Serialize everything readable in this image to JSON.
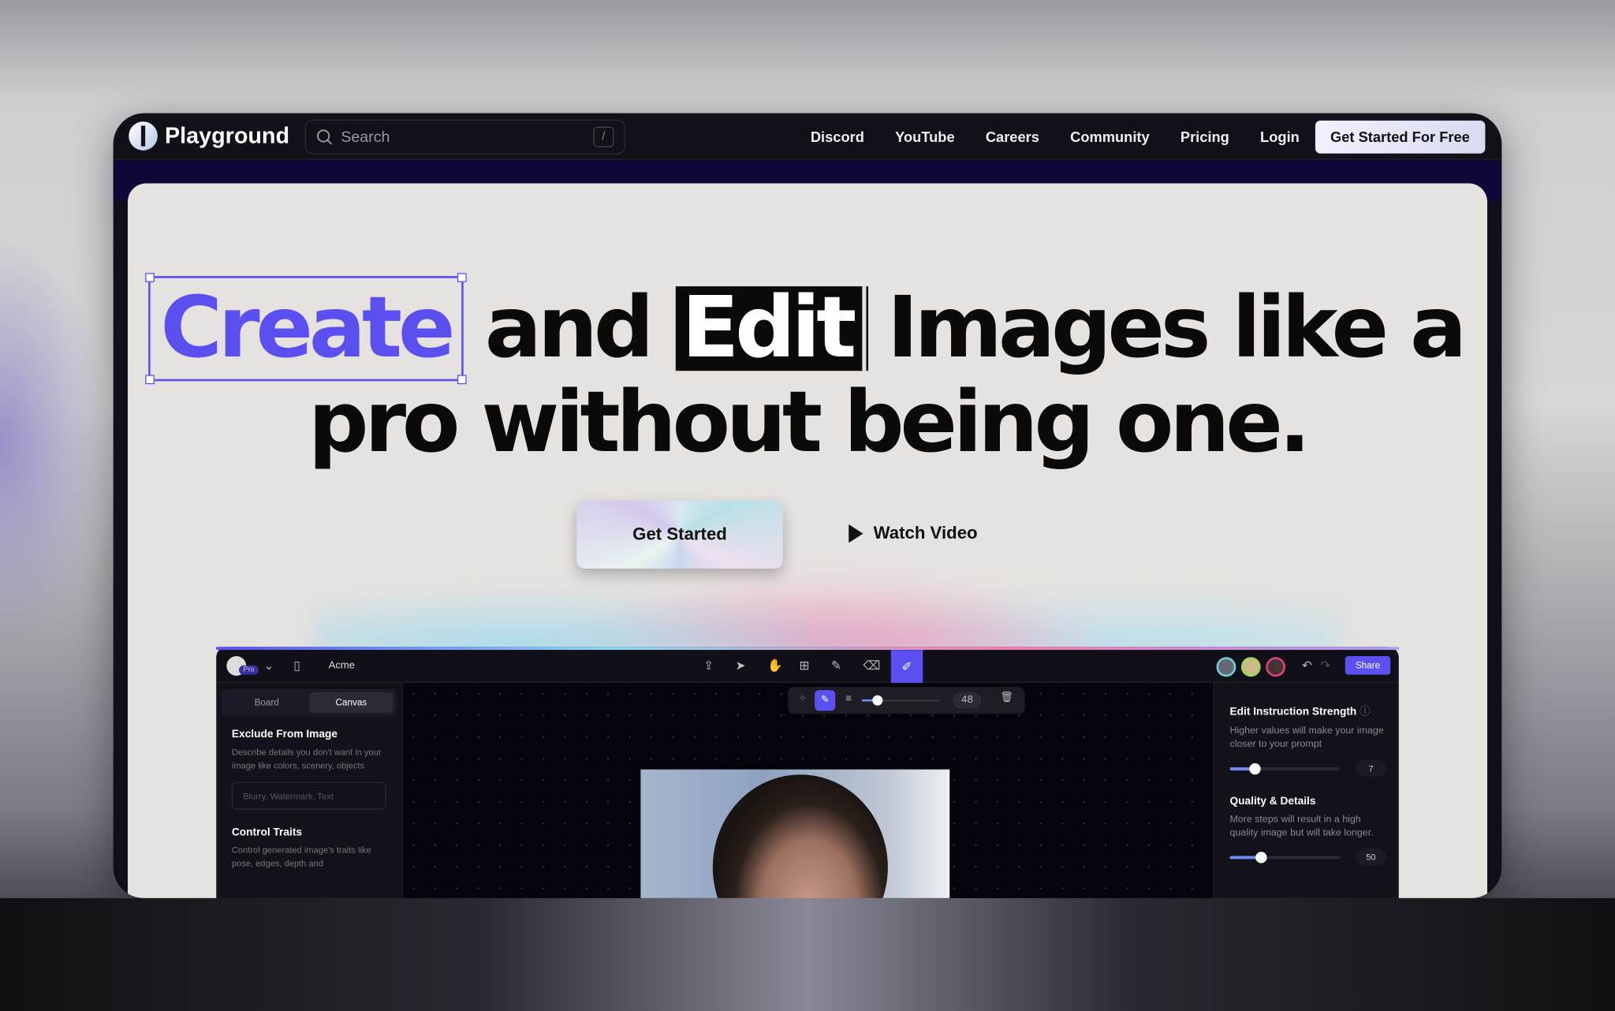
{
  "nav": {
    "brand": "Playground",
    "search_placeholder": "Search",
    "search_shortcut": "/",
    "links": [
      "Discord",
      "YouTube",
      "Careers",
      "Community",
      "Pricing",
      "Login"
    ],
    "cta": "Get Started For Free"
  },
  "hero": {
    "word_create": "Create",
    "word_and": "and",
    "word_edit": "Edit",
    "rest_line1": "Images like a",
    "line2": "pro without being one.",
    "primary_button": "Get Started",
    "secondary_button": "Watch Video"
  },
  "app": {
    "badge": "Pro",
    "workspace": "Acme",
    "share": "Share",
    "tabs": [
      "Board",
      "Canvas"
    ],
    "active_tab": "Canvas",
    "left": {
      "exclude_title": "Exclude From Image",
      "exclude_desc": "Describe details you don't want in your image like colors, scenery, objects",
      "exclude_placeholder": "Blurry, Watermark, Text",
      "traits_title": "Control Traits",
      "traits_desc": "Control generated image's traits like pose, edges, depth and"
    },
    "brush_size": "48",
    "right": {
      "strength_title": "Edit Instruction Strength",
      "strength_desc": "Higher values will make your image closer to your prompt",
      "strength_value": "7",
      "strength_fraction": 0.22,
      "quality_title": "Quality & Details",
      "quality_desc": "More steps will result in a high quality image but will take longer.",
      "quality_value": "50",
      "quality_fraction": 0.28
    },
    "accent": "#5b4ff0"
  }
}
